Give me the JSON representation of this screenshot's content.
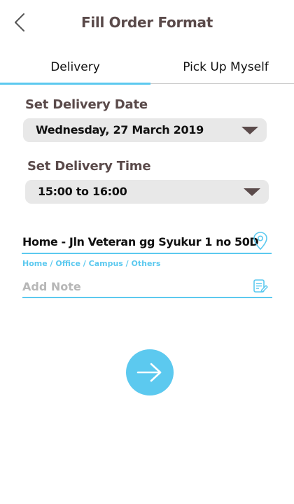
{
  "header": {
    "title": "Fill Order Format",
    "back_icon": "chevron-left-icon"
  },
  "tabs": [
    {
      "label": "Delivery",
      "active": true
    },
    {
      "label": "Pick Up Myself",
      "active": false
    }
  ],
  "delivery_date": {
    "label": "Set Delivery Date",
    "value": "Wednesday, 27 March 2019"
  },
  "delivery_time": {
    "label": "Set Delivery Time",
    "value": "15:00 to 16:00"
  },
  "address": {
    "value": "Home  - Jln Veteran gg Syukur 1 no 50D",
    "icon": "location-pin-icon",
    "types": "Home / Office / Campus / Others"
  },
  "note": {
    "placeholder": "Add Note",
    "value": "",
    "icon": "note-edit-icon"
  },
  "next_button": {
    "icon": "arrow-right-icon"
  },
  "colors": {
    "accent": "#5cc9ef",
    "title": "#5a4a4a",
    "select_bg": "#e8e8e8",
    "caret": "#5b4b4b"
  }
}
